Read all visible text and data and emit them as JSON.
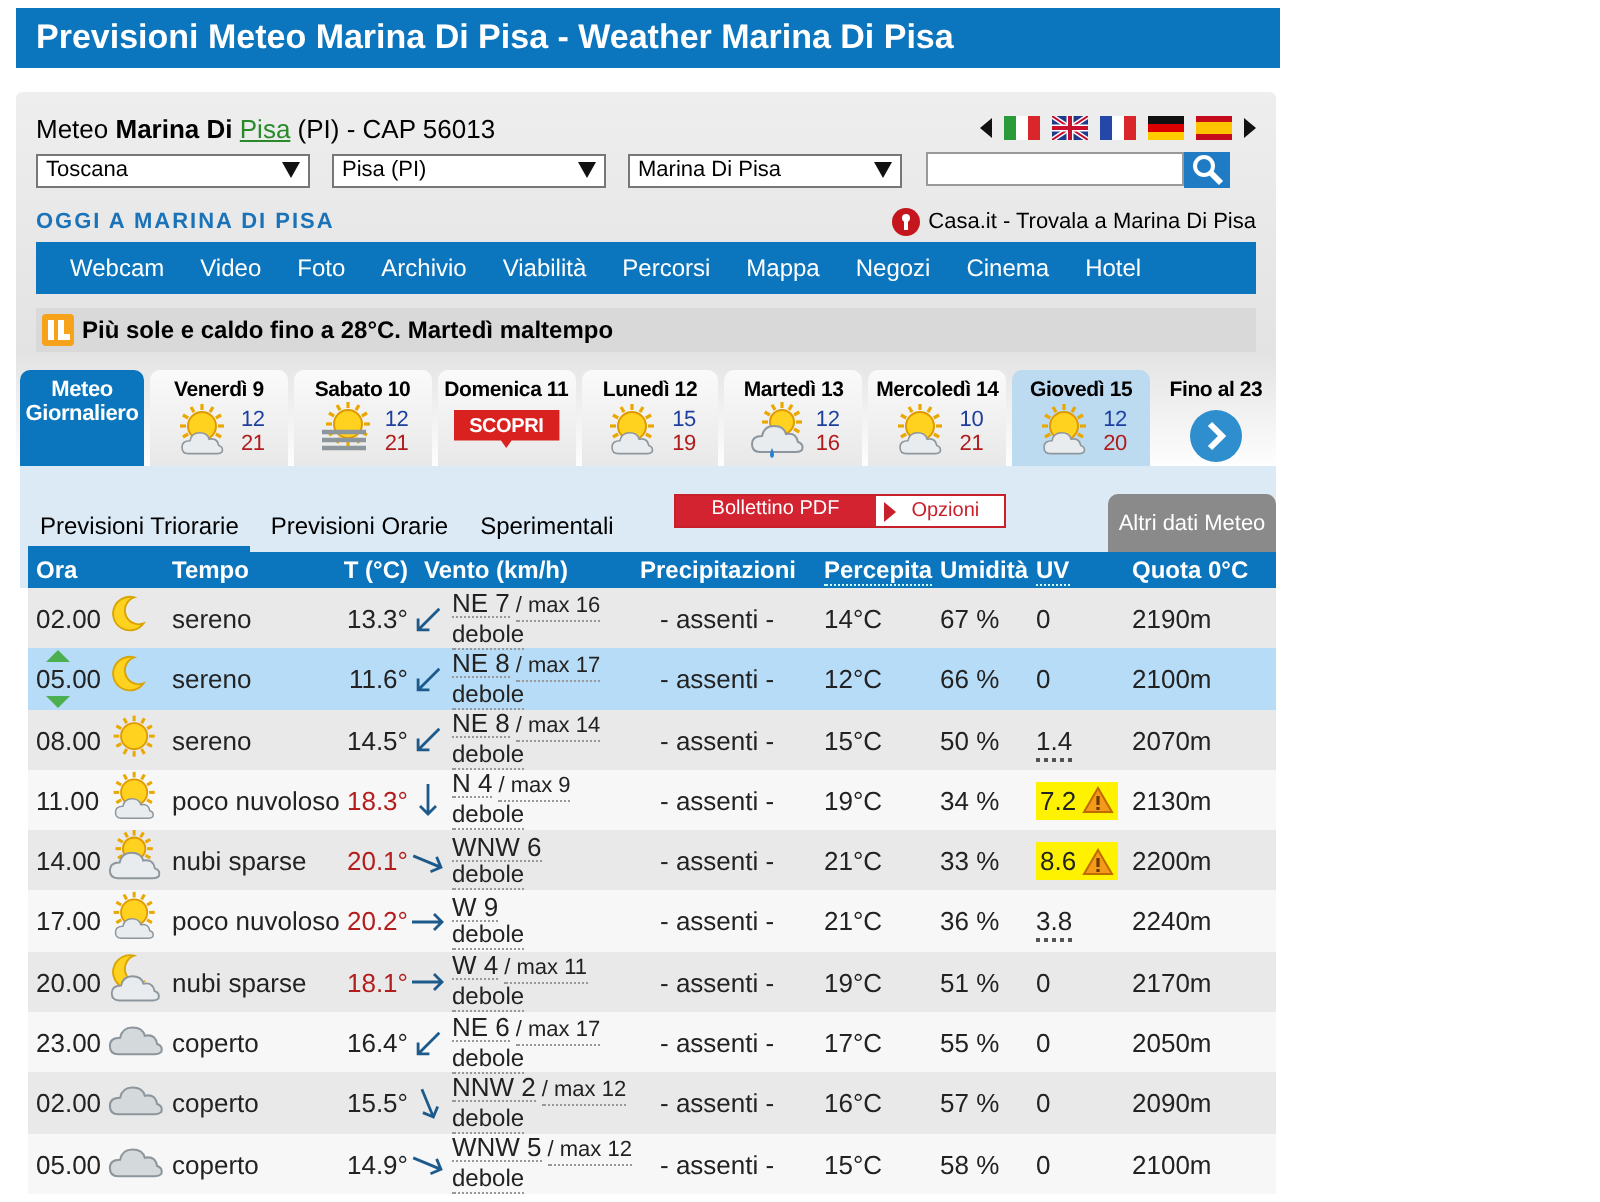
{
  "title": "Previsioni Meteo Marina Di Pisa - Weather Marina Di Pisa",
  "location": {
    "prefix": "Meteo",
    "place": "Marina Di",
    "link": "Pisa",
    "suffix": "(PI) - CAP 56013"
  },
  "selects": [
    {
      "value": "Toscana"
    },
    {
      "value": "Pisa (PI)"
    },
    {
      "value": "Marina Di Pisa"
    }
  ],
  "today_link": "OGGI A MARINA DI PISA",
  "promo": "Casa.it - Trovala a Marina Di Pisa",
  "nav": [
    "Webcam",
    "Video",
    "Foto",
    "Archivio",
    "Viabilità",
    "Percorsi",
    "Mappa",
    "Negozi",
    "Cinema",
    "Hotel"
  ],
  "news": "Più sole e caldo fino a 28°C. Martedì maltempo",
  "day_tabs": [
    {
      "kind": "main",
      "label": "Meteo Giornaliero",
      "selected": true
    },
    {
      "kind": "day",
      "label": "Venerdì 9",
      "icon": {
        "kind": "sun-cloud"
      },
      "min": "12",
      "max": "21",
      "selected": false,
      "highlighted": false
    },
    {
      "kind": "day",
      "label": "Sabato 10",
      "icon": {
        "kind": "haze"
      },
      "min": "12",
      "max": "21",
      "selected": false,
      "highlighted": false
    },
    {
      "kind": "promo",
      "label": "Domenica 11",
      "button": "SCOPRI",
      "selected": false,
      "highlighted": false
    },
    {
      "kind": "day",
      "label": "Lunedì 12",
      "icon": {
        "kind": "sun-cloud"
      },
      "min": "15",
      "max": "19",
      "selected": false,
      "highlighted": false
    },
    {
      "kind": "day",
      "label": "Martedì 13",
      "icon": {
        "kind": "rain"
      },
      "min": "12",
      "max": "16",
      "selected": false,
      "highlighted": false
    },
    {
      "kind": "day",
      "label": "Mercoledì 14",
      "icon": {
        "kind": "sun-cloud"
      },
      "min": "10",
      "max": "21",
      "selected": false,
      "highlighted": false
    },
    {
      "kind": "day",
      "label": "Giovedì 15",
      "icon": {
        "kind": "sun-cloud"
      },
      "min": "12",
      "max": "20",
      "selected": false,
      "highlighted": true
    },
    {
      "kind": "more",
      "label": "Fino al 23",
      "selected": false
    }
  ],
  "subtabs": [
    {
      "label": "Previsioni Triorarie",
      "selected": true
    },
    {
      "label": "Previsioni Orarie",
      "selected": false
    },
    {
      "label": "Sperimentali",
      "selected": false
    }
  ],
  "pdf_button": "Bollettino PDF",
  "options_button": "Opzioni",
  "more_data": "Altri dati Meteo",
  "table": {
    "columns": [
      "Ora",
      "Tempo",
      "T (°C)",
      "Vento (km/h)",
      "Precipitazioni",
      "Percepita",
      "Umidità",
      "UV",
      "Quota 0°C"
    ],
    "rows": [
      {
        "time": "02.00",
        "icon": {
          "kind": "moon"
        },
        "weather": "sereno",
        "temp": "13.3°",
        "warm": false,
        "wind_dir": "NE",
        "wind_speed": "7",
        "gust": "/ max 16",
        "strength": "debole",
        "rain": "- assenti -",
        "feel": "14°C",
        "humidity": "67 %",
        "uv": "0",
        "uv_dotted": false,
        "uv_alert": false,
        "freezing": "2190m",
        "selected": false
      },
      {
        "time": "05.00",
        "icon": {
          "kind": "moon"
        },
        "weather": "sereno",
        "temp": "11.6°",
        "warm": false,
        "wind_dir": "NE",
        "wind_speed": "8",
        "gust": "/ max 17",
        "strength": "debole",
        "rain": "- assenti -",
        "feel": "12°C",
        "humidity": "66 %",
        "uv": "0",
        "uv_dotted": false,
        "uv_alert": false,
        "freezing": "2100m",
        "selected": true
      },
      {
        "time": "08.00",
        "icon": {
          "kind": "sun"
        },
        "weather": "sereno",
        "temp": "14.5°",
        "warm": false,
        "wind_dir": "NE",
        "wind_speed": "8",
        "gust": "/ max 14",
        "strength": "debole",
        "rain": "- assenti -",
        "feel": "15°C",
        "humidity": "50 %",
        "uv": "1.4",
        "uv_dotted": true,
        "uv_alert": false,
        "freezing": "2070m",
        "selected": false
      },
      {
        "time": "11.00",
        "icon": {
          "kind": "sun-cloud"
        },
        "weather": "poco nuvoloso",
        "temp": "18.3°",
        "warm": true,
        "wind_dir": "N",
        "wind_speed": "4",
        "gust": "/ max 9",
        "strength": "debole",
        "rain": "- assenti -",
        "feel": "19°C",
        "humidity": "34 %",
        "uv": "7.2",
        "uv_dotted": false,
        "uv_alert": true,
        "freezing": "2130m",
        "selected": false
      },
      {
        "time": "14.00",
        "icon": {
          "kind": "cloud-sun"
        },
        "weather": "nubi sparse",
        "temp": "20.1°",
        "warm": true,
        "wind_dir": "WNW",
        "wind_speed": "6",
        "strength": "debole",
        "rain": "- assenti -",
        "feel": "21°C",
        "humidity": "33 %",
        "uv": "8.6",
        "uv_dotted": false,
        "uv_alert": true,
        "freezing": "2200m",
        "selected": false
      },
      {
        "time": "17.00",
        "icon": {
          "kind": "sun-cloud"
        },
        "weather": "poco nuvoloso",
        "temp": "20.2°",
        "warm": true,
        "wind_dir": "W",
        "wind_speed": "9",
        "strength": "debole",
        "rain": "- assenti -",
        "feel": "21°C",
        "humidity": "36 %",
        "uv": "3.8",
        "uv_dotted": true,
        "uv_alert": false,
        "freezing": "2240m",
        "selected": false
      },
      {
        "time": "20.00",
        "icon": {
          "kind": "cloud-moon"
        },
        "weather": "nubi sparse",
        "temp": "18.1°",
        "warm": true,
        "wind_dir": "W",
        "wind_speed": "4",
        "gust": "/ max 11",
        "strength": "debole",
        "rain": "- assenti -",
        "feel": "19°C",
        "humidity": "51 %",
        "uv": "0",
        "uv_dotted": false,
        "uv_alert": false,
        "freezing": "2170m",
        "selected": false
      },
      {
        "time": "23.00",
        "icon": {
          "kind": "cloud"
        },
        "weather": "coperto",
        "temp": "16.4°",
        "warm": false,
        "wind_dir": "NE",
        "wind_speed": "6",
        "gust": "/ max 17",
        "strength": "debole",
        "rain": "- assenti -",
        "feel": "17°C",
        "humidity": "55 %",
        "uv": "0",
        "uv_dotted": false,
        "uv_alert": false,
        "freezing": "2050m",
        "selected": false
      },
      {
        "time": "02.00",
        "icon": {
          "kind": "cloud"
        },
        "weather": "coperto",
        "temp": "15.5°",
        "warm": false,
        "wind_dir": "NNW",
        "wind_speed": "2",
        "gust": "/ max 12",
        "strength": "debole",
        "rain": "- assenti -",
        "feel": "16°C",
        "humidity": "57 %",
        "uv": "0",
        "uv_dotted": false,
        "uv_alert": false,
        "freezing": "2090m",
        "selected": false
      },
      {
        "time": "05.00",
        "icon": {
          "kind": "cloud"
        },
        "weather": "coperto",
        "temp": "14.9°",
        "warm": false,
        "wind_dir": "WNW",
        "wind_speed": "5",
        "gust": "/ max 12",
        "strength": "debole",
        "rain": "- assenti -",
        "feel": "15°C",
        "humidity": "58 %",
        "uv": "0",
        "uv_dotted": false,
        "uv_alert": false,
        "freezing": "2100m",
        "selected": false
      }
    ]
  }
}
